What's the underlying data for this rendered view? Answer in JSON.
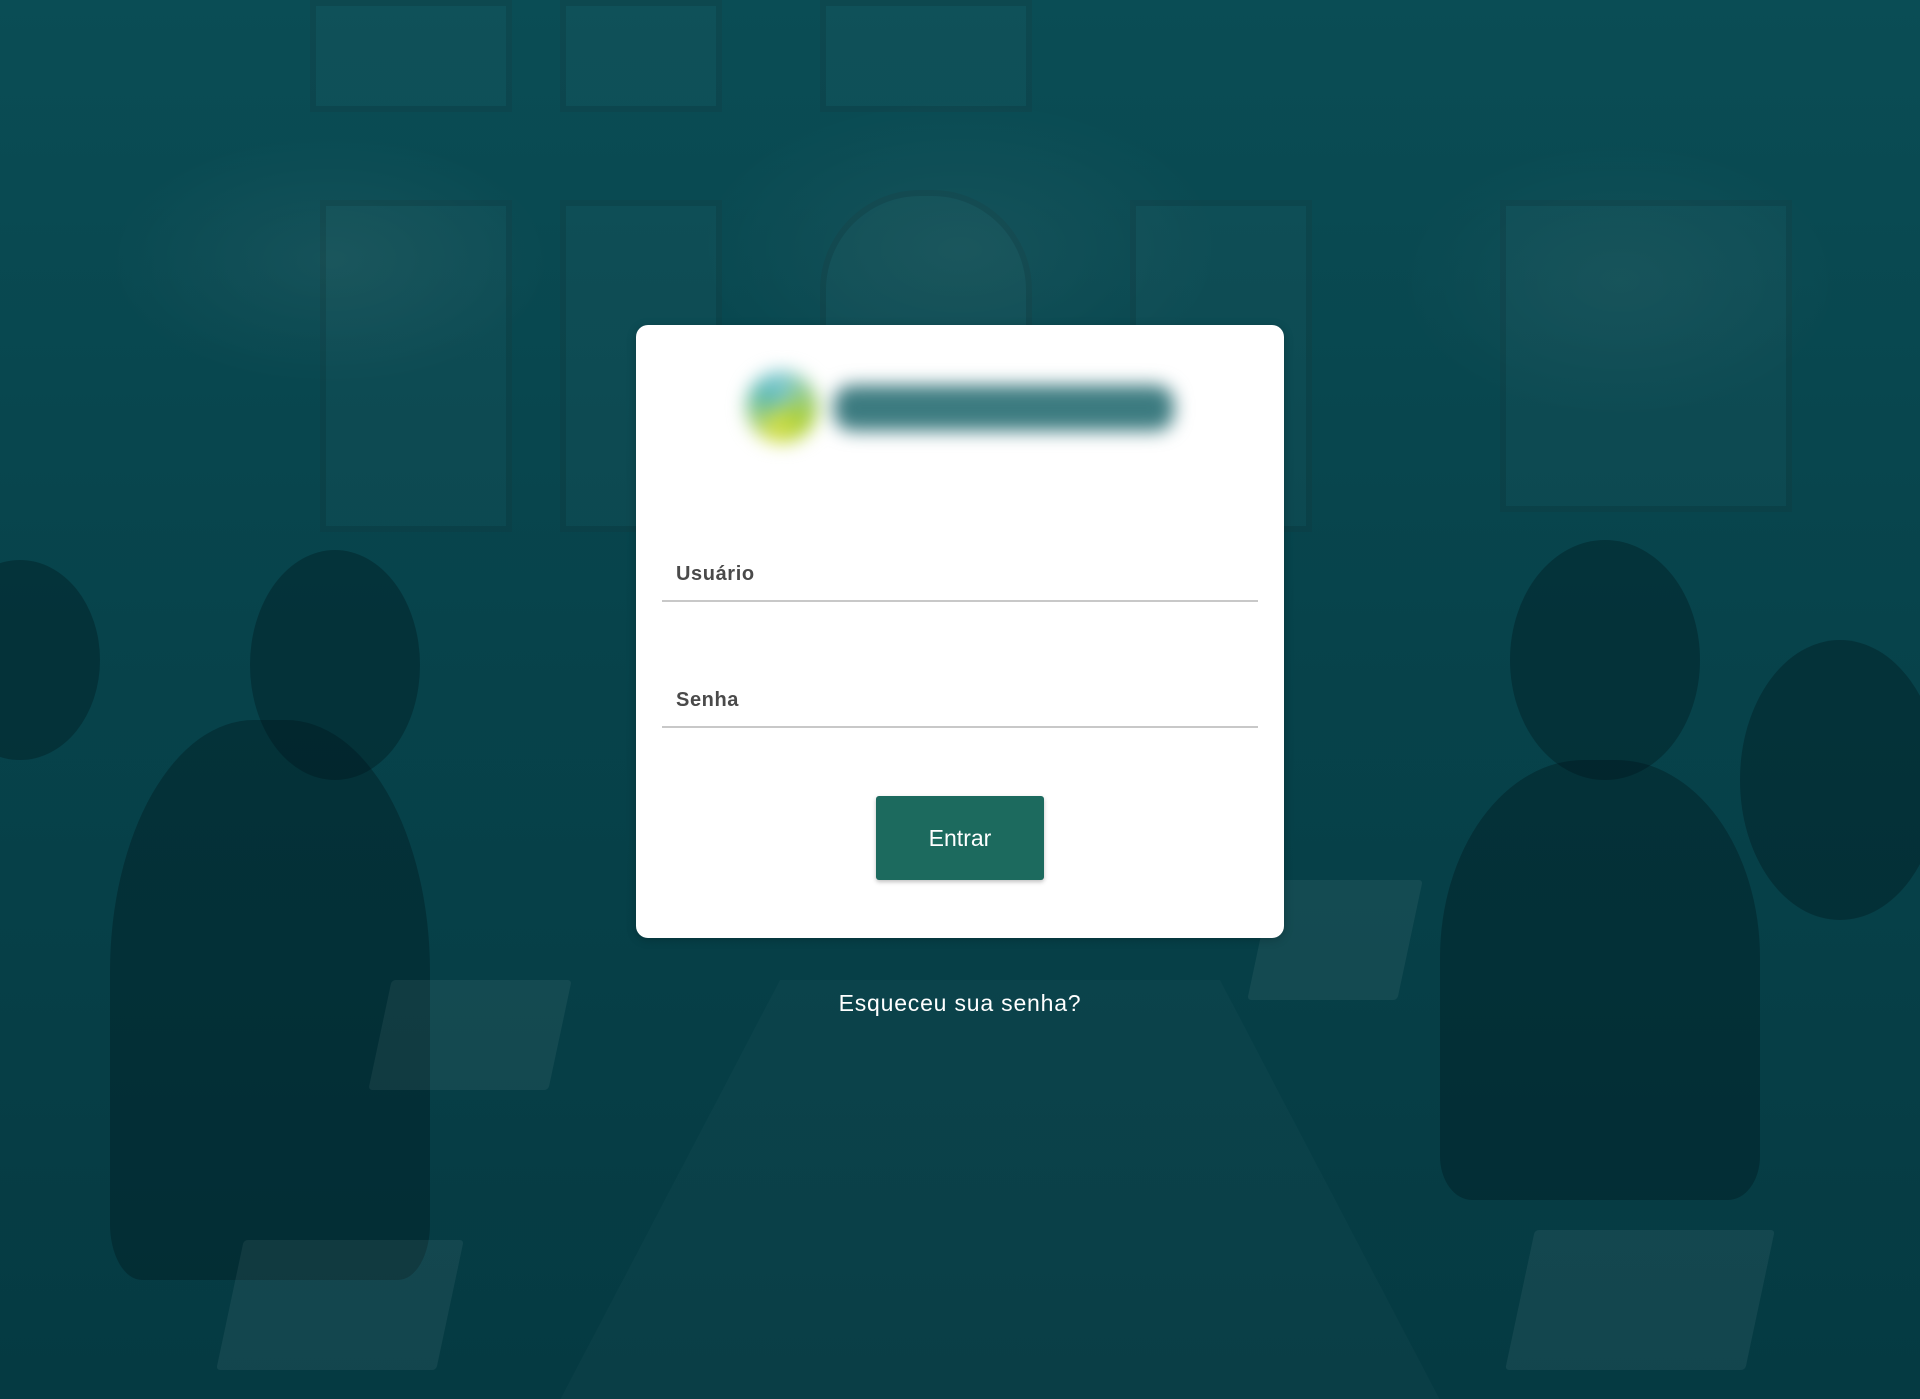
{
  "login": {
    "username_placeholder": "Usuário",
    "password_placeholder": "Senha",
    "submit_label": "Entrar",
    "forgot_password_label": "Esqueceu sua senha?"
  },
  "colors": {
    "background_overlay": "#07434b",
    "card_background": "#ffffff",
    "button_background": "#1c6a5e",
    "button_text": "#ffffff",
    "link_text": "#ffffff"
  },
  "icons": {
    "logo": "company-logo-blurred"
  }
}
